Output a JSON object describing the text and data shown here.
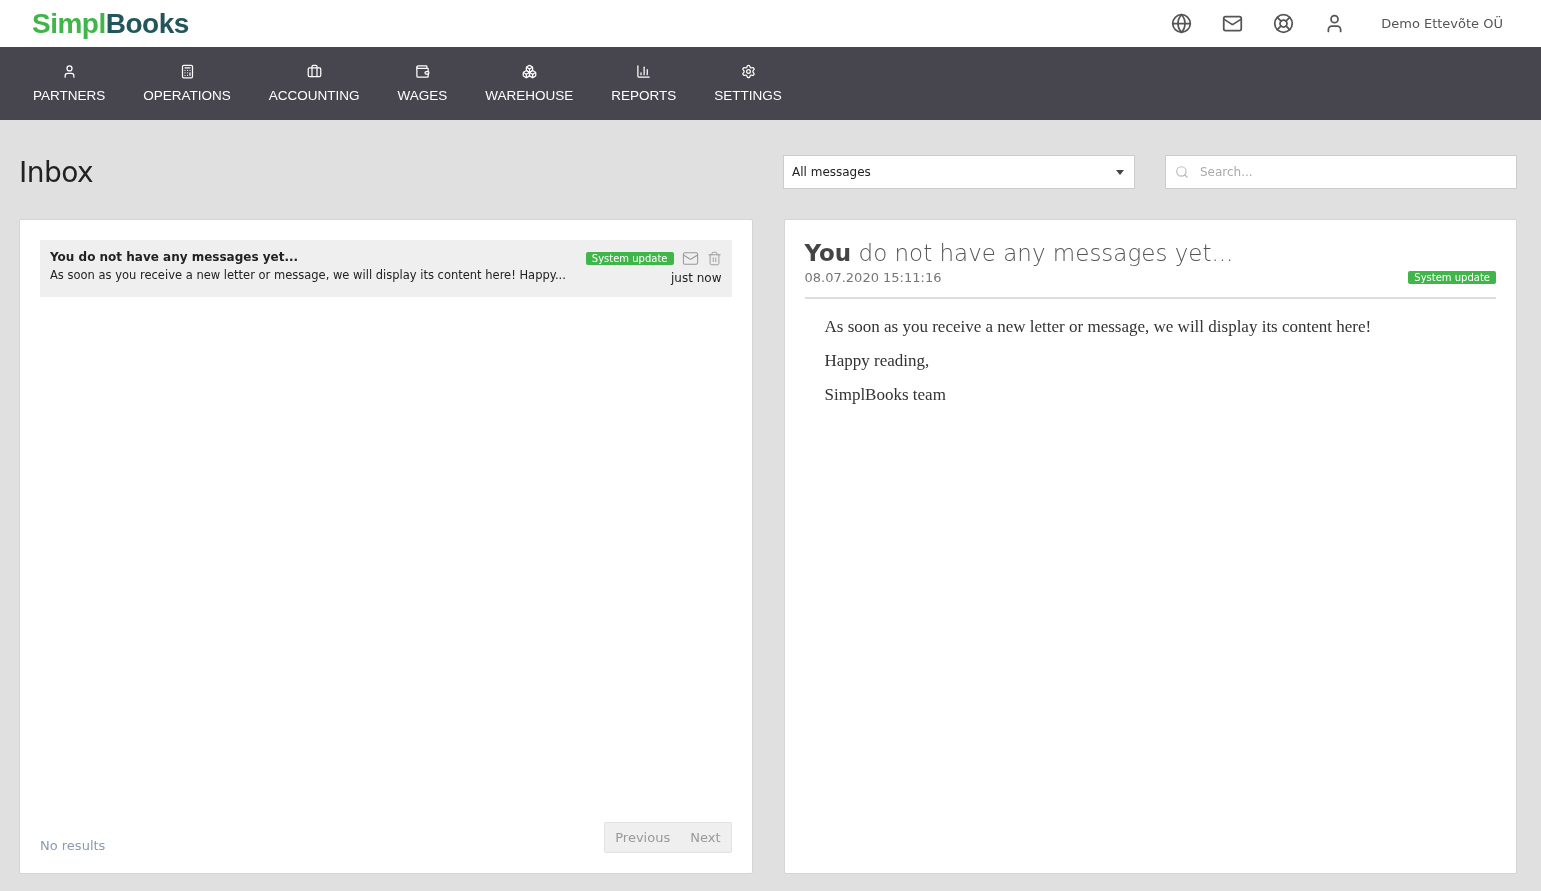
{
  "logo": {
    "first": "Simpl",
    "second": "Books"
  },
  "header_icons": [
    {
      "kind": "globe"
    },
    {
      "kind": "mail"
    },
    {
      "kind": "help"
    },
    {
      "kind": "user"
    }
  ],
  "company": "Demo Ettevõte OÜ",
  "nav": [
    {
      "label": "PARTNERS",
      "kind": "partners"
    },
    {
      "label": "OPERATIONS",
      "kind": "operations"
    },
    {
      "label": "ACCOUNTING",
      "kind": "accounting"
    },
    {
      "label": "WAGES",
      "kind": "wages"
    },
    {
      "label": "WAREHOUSE",
      "kind": "warehouse"
    },
    {
      "label": "REPORTS",
      "kind": "reports"
    },
    {
      "label": "SETTINGS",
      "kind": "settings"
    }
  ],
  "page_title": "Inbox",
  "filter": {
    "value": "All messages"
  },
  "search": {
    "placeholder": "Search..."
  },
  "messages": [
    {
      "title": "You do not have any messages yet...",
      "preview": "As soon as you receive a new letter or message, we will display its content here! Happy...",
      "tag": "System update",
      "time": "just now",
      "selected": true
    }
  ],
  "list_footer": {
    "status": "No results",
    "buttons": [
      {
        "label": "Previous",
        "disabled": true
      },
      {
        "label": "Next",
        "disabled": true
      }
    ]
  },
  "detail": {
    "title": "**You** do not have any messages yet...",
    "date": "08.07.2020 15:11:16",
    "tag": "System update",
    "paragraphs": [
      "As soon as you receive a new letter or message, we will display its content here!",
      "Happy reading,",
      "SimplBooks team"
    ]
  }
}
